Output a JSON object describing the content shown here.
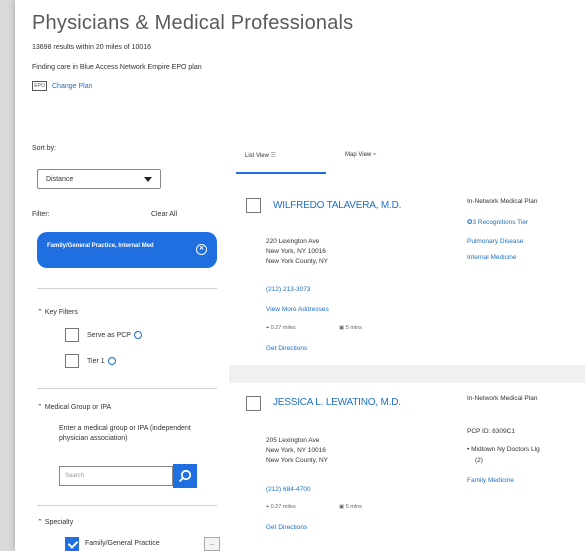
{
  "header": {
    "title": "Physicians & Medical Professionals",
    "results": "13698 results within 20 miles of 10016",
    "plan_text": "Finding care in Blue Access Network Empire EPO plan",
    "change_plan": "Change Plan",
    "plan_icon": "EPO"
  },
  "sidebar": {
    "sort_label": "Sort by:",
    "sort_value": "Distance",
    "filter_label": "Filter:",
    "clear_all": "Clear All",
    "active_filter": "Family/General Practice, Internal Med",
    "key_filters_title": "Key Filters",
    "key_filters": [
      {
        "label": "Serve as PCP",
        "checked": false
      },
      {
        "label": "Tier 1",
        "checked": false
      }
    ],
    "medical_group_title": "Medical Group or IPA",
    "medical_group_desc": "Enter a medical group or IPA (independent physician association)",
    "search_placeholder": "Search",
    "specialty_title": "Specialty",
    "specialty_item": "Family/General Practice",
    "more_label": "..."
  },
  "tabs": [
    {
      "label": "List View",
      "active": true
    },
    {
      "label": "Map View",
      "active": false
    }
  ],
  "results": [
    {
      "name": "WILFREDO TALAVERA, M.D.",
      "addr1": "220 Lexington Ave",
      "addr2": "New York, NY 10016",
      "county": "New York County, NY",
      "phone": "(212) 213-3073",
      "more": "View More Addresses",
      "distance": "0.27 miles",
      "lang": "5 mins",
      "directions": "Get Directions",
      "plan_title": "In-Network Medical Plan",
      "recognition": "3 Recognitions Tier",
      "spec1": "Pulmonary Disease",
      "spec2": "Internal Medicine"
    },
    {
      "name": "JESSICA L. LEWATINO, M.D.",
      "addr1": "205 Lexington Ave",
      "addr2": "New York, NY 10016",
      "county": "New York County, NY",
      "phone": "(212) 684-4700",
      "distance": "0.27 miles",
      "lang": "5 mins",
      "directions": "Get Directions",
      "plan_title": "In-Network Medical Plan",
      "pcp": "PCP ID: 8309C1",
      "group": "Midtown Ny Doctors Llg",
      "group2": "(2)",
      "spec1": "Family Medicine"
    }
  ],
  "colors": {
    "accent": "#1f6fe0",
    "link": "#1f6fc7"
  }
}
